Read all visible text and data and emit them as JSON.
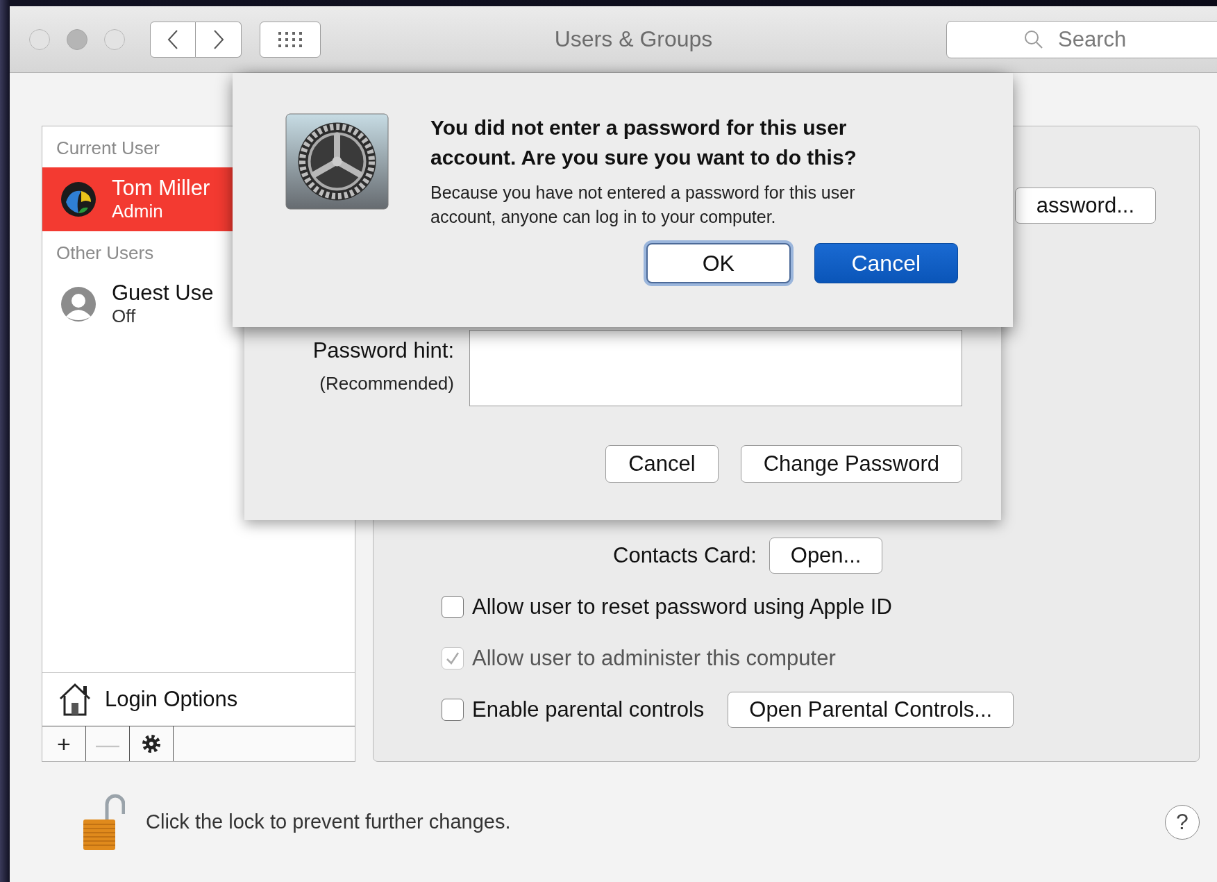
{
  "window": {
    "title": "Users & Groups"
  },
  "search": {
    "placeholder": "Search"
  },
  "sidebar": {
    "sections": [
      {
        "header": "Current User",
        "users": [
          {
            "name": "Tom Miller",
            "role": "Admin",
            "selected": true,
            "kind": "photo"
          }
        ]
      },
      {
        "header": "Other Users",
        "users": [
          {
            "name": "Guest Use",
            "role": "Off",
            "selected": false,
            "kind": "silhouette"
          }
        ]
      }
    ],
    "login_options": "Login Options",
    "add_button": {
      "label": "+"
    },
    "remove_button": {
      "label": "—",
      "disabled": true
    }
  },
  "panel": {
    "password_button": "assword...",
    "contacts_card": {
      "label": "Contacts Card:",
      "button": "Open..."
    },
    "options": [
      {
        "label": "Allow user to reset password using Apple ID",
        "checked": false,
        "disabled": false
      },
      {
        "label": "Allow user to administer this computer",
        "checked": true,
        "disabled": true
      },
      {
        "label": "Enable parental controls",
        "checked": false,
        "disabled": false,
        "button": "Open Parental Controls..."
      }
    ]
  },
  "sheet": {
    "hint_label": "Password hint:",
    "hint_note": "(Recommended)",
    "buttons": [
      {
        "label": "Cancel"
      },
      {
        "label": "Change Password"
      }
    ]
  },
  "alert": {
    "title": "You did not enter a password for this user account. Are you sure you want to do this?",
    "message": "Because you have not entered a password for this user account, anyone can log in to your computer.",
    "buttons": [
      {
        "label": "OK",
        "kind": "focused"
      },
      {
        "label": "Cancel",
        "kind": "default"
      }
    ]
  },
  "footer": {
    "lock_text": "Click the lock to prevent further changes.",
    "help": "?"
  }
}
